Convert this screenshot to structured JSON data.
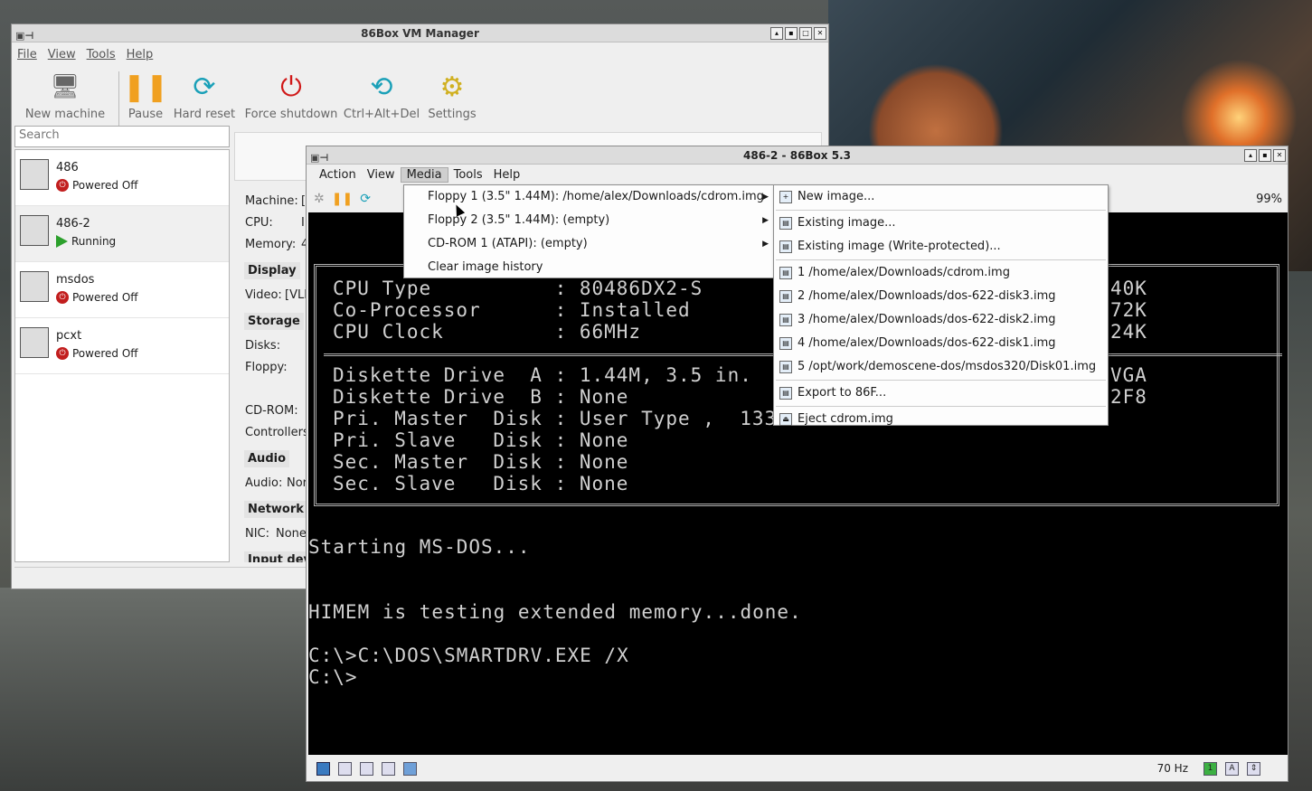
{
  "manager": {
    "title": "86Box VM Manager",
    "menu": [
      "File",
      "View",
      "Tools",
      "Help"
    ],
    "toolbar": [
      {
        "label": "New machine",
        "icon": "new-machine-icon"
      },
      {
        "label": "Pause",
        "icon": "pause-icon"
      },
      {
        "label": "Hard reset",
        "icon": "hard-reset-icon"
      },
      {
        "label": "Force shutdown",
        "icon": "power-icon"
      },
      {
        "label": "Ctrl+Alt+Del",
        "icon": "ctrl-alt-del-icon"
      },
      {
        "label": "Settings",
        "icon": "settings-gear-icon"
      }
    ],
    "search_placeholder": "Search",
    "vms": [
      {
        "name": "486",
        "status": "Powered Off"
      },
      {
        "name": "486-2",
        "status": "Running"
      },
      {
        "name": "msdos",
        "status": "Powered Off"
      },
      {
        "name": "pcxt",
        "status": "Powered Off"
      }
    ],
    "info": {
      "machine": "Machine:",
      "machine_val": "[",
      "cpu": "CPU:",
      "cpu_val": "I",
      "memory": "Memory:",
      "memory_val": "4",
      "display": "Display",
      "video": "Video:",
      "video_val": "[VLE",
      "storage": "Storage",
      "disks": "Disks:",
      "floppy": "Floppy:",
      "cdrom": "CD-ROM:",
      "controllers": "Controllers",
      "audio_head": "Audio",
      "audio": "Audio:",
      "audio_val": "Nor",
      "network": "Network",
      "nic": "NIC:",
      "nic_val": "None",
      "input": "Input dev"
    }
  },
  "vmwindow": {
    "title": "486-2 - 86Box 5.3",
    "menu": [
      "Action",
      "View",
      "Media",
      "Tools",
      "Help"
    ],
    "speed": "99%",
    "status_hz": "70 Hz",
    "bios_lines": [
      "CPU Type          : 80486DX2-S",
      "Co-Processor      : Installed",
      "CPU Clock         : 66MHz"
    ],
    "bios_right_top": [
      "40K",
      "72K",
      "24K"
    ],
    "drive_lines": [
      "Diskette Drive  A : 1.44M, 3.5 in.",
      "Diskette Drive  B : None",
      "Pri. Master  Disk : User Type ,  133",
      "Pri. Slave   Disk : None",
      "Sec. Master  Disk : None",
      "Sec. Slave   Disk : None"
    ],
    "drive_right": [
      "VGA",
      "2F8"
    ],
    "dos_lines": [
      "Starting MS-DOS...",
      "HIMEM is testing extended memory...done.",
      "C:\\>C:\\DOS\\SMARTDRV.EXE /X",
      "C:\\>"
    ]
  },
  "media_menu": [
    "Floppy 1 (3.5\" 1.44M): /home/alex/Downloads/cdrom.img",
    "Floppy 2 (3.5\" 1.44M): (empty)",
    "CD-ROM 1 (ATAPI): (empty)",
    "Clear image history"
  ],
  "floppy_submenu": {
    "new": "New image...",
    "existing": "Existing image...",
    "existing_wp": "Existing image (Write-protected)...",
    "history": [
      "1 /home/alex/Downloads/cdrom.img",
      "2 /home/alex/Downloads/dos-622-disk3.img",
      "3 /home/alex/Downloads/dos-622-disk2.img",
      "4 /home/alex/Downloads/dos-622-disk1.img",
      "5 /opt/work/demoscene-dos/msdos320/Disk01.img"
    ],
    "export": "Export to 86F...",
    "eject": "Eject cdrom.img"
  },
  "colors": {
    "power_off": "#c21e1e",
    "running": "#2ca02c",
    "pause": "#f0a020",
    "reset": "#1aa0b8"
  }
}
